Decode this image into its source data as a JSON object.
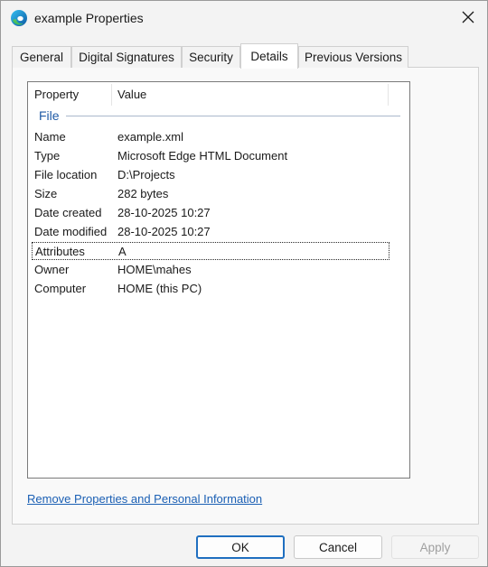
{
  "window": {
    "title": "example Properties"
  },
  "tabs": [
    {
      "label": "General"
    },
    {
      "label": "Digital Signatures"
    },
    {
      "label": "Security"
    },
    {
      "label": "Details",
      "active": true
    },
    {
      "label": "Previous Versions"
    }
  ],
  "details": {
    "columns": {
      "property": "Property",
      "value": "Value"
    },
    "group": "File",
    "rows": [
      {
        "property": "Name",
        "value": "example.xml"
      },
      {
        "property": "Type",
        "value": "Microsoft Edge HTML Document"
      },
      {
        "property": "File location",
        "value": "D:\\Projects"
      },
      {
        "property": "Size",
        "value": "282 bytes"
      },
      {
        "property": "Date created",
        "value": "28-10-2025 10:27"
      },
      {
        "property": "Date modified",
        "value": "28-10-2025 10:27"
      },
      {
        "property": "Attributes",
        "value": "A",
        "selected": true
      },
      {
        "property": "Owner",
        "value": "HOME\\mahes"
      },
      {
        "property": "Computer",
        "value": "HOME (this PC)"
      }
    ]
  },
  "remove_link": "Remove Properties and Personal Information",
  "buttons": {
    "ok": "OK",
    "cancel": "Cancel",
    "apply": "Apply"
  },
  "icons": {
    "app": "edge-icon",
    "close": "close-icon"
  },
  "colors": {
    "link": "#1a5fb4",
    "group": "#1f5aa6",
    "default_button_border": "#1f6fc0"
  }
}
